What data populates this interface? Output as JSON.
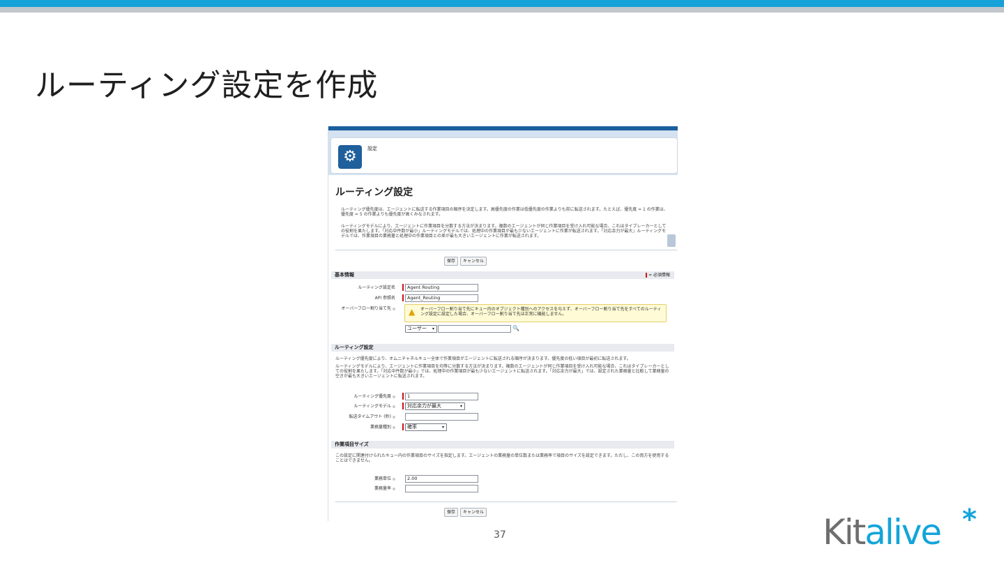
{
  "slide": {
    "title": "ルーティング設定を作成",
    "page_number": "37",
    "logo_main": "Kit",
    "logo_accent": "alive",
    "logo_star": "*"
  },
  "screenshot": {
    "header_label": "設定",
    "page_title": "ルーティング設定",
    "desc1": "ルーティング優先度は、エージェントに転送する作業項目の順序を決定します。高優先度の作業は低優先度の作業よりも前に転送されます。たとえば、優先度 = 1 の作業は、優先度 = 5 の作業よりも優先度が高くみなされます。",
    "desc2": "ルーティングモデルにより、エージェントに作業項目を分散する方法が決まります。複数のエージェントが同じ作業項目を受け入れ可能な場合、これはタイブレーカーとしての役割を果たします。「対応中件数が最小」ルーティングモデルでは、処理中の作業項目が最も少ないエージェントに作業が転送されます。「対応余力が最大」ルーティングモデルでは、作業項目の業務量と処理中の作業項目との差が最も大きいエージェントに作業が転送されます。",
    "buttons": {
      "save": "保存",
      "cancel": "キャンセル"
    },
    "basic_info": {
      "header": "基本情報",
      "required_note": "= 必須情報",
      "routing_name_label": "ルーティング設定名",
      "routing_name_value": "Agent Routing",
      "api_name_label": "API 参照名",
      "api_name_value": "Agent_Routing",
      "overflow_label": "オーバーフロー割り当て先",
      "overflow_warning": "オーバーフロー割り当て先にキュー内のオブジェクト種別へのアクセスを与えず、オーバーフロー割り当て先をすべてのルーティング設定に設定した場合、オーバーフロー割り当て先は正常に機能しません。",
      "overflow_type_value": "ユーザー"
    },
    "routing_settings": {
      "header": "ルーティング設定",
      "desc1": "ルーティング優先度により、オムニチャネルキュー全体で作業項目がエージェントに転送される順序が決まります。優先度の低い項目が最初に転送されます。",
      "desc2": "ルーティングモデルにより、エージェントに作業項目を均等に分散する方法が決まります。複数のエージェントが同じ作業項目を受け入れ可能な場合、これはタイブレーカーとしての役割を果たします。「対応中件数が最小」では、処理中の作業項目が最も少ないエージェントに転送されます。「対応余力が最大」では、設定された業務量と比較して業務量の空きが最も大きいエージェントに転送されます。",
      "priority_label": "ルーティング優先度",
      "priority_value": "1",
      "model_label": "ルーティングモデル",
      "model_value": "対応余力が最大",
      "timeout_label": "転送タイムアウト (秒)",
      "timeout_value": "",
      "capacity_type_label": "業務量種別",
      "capacity_type_value": "確率"
    },
    "work_item_size": {
      "header": "作業項目サイズ",
      "desc": "この設定に関連付けられたキュー内の作業項目のサイズを指定します。エージェントの業務量の単位数または業務率で項目のサイズを設定できます。ただし、この両方を使用することはできません。",
      "units_label": "業務単位",
      "units_value": "2.00",
      "percent_label": "業務量率",
      "percent_value": ""
    }
  },
  "colors": {
    "top_band": "#16a1d8",
    "brand_blue": "#1f5f9b",
    "required_red": "#cc1111"
  }
}
